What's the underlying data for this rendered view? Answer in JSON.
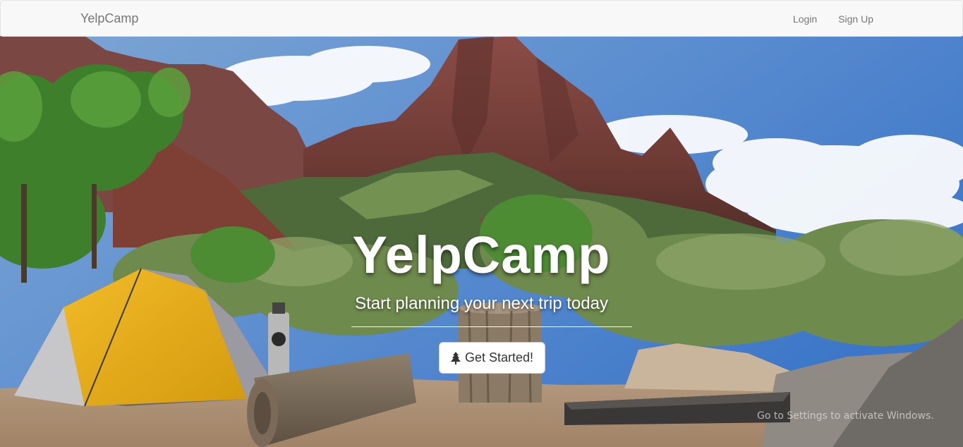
{
  "navbar": {
    "brand": "YelpCamp",
    "links": [
      {
        "label": "Login"
      },
      {
        "label": "Sign Up"
      }
    ]
  },
  "landing": {
    "title": "YelpCamp",
    "subtitle": "Start planning your next trip today",
    "cta_label": "Get Started!",
    "cta_icon": "tree-icon"
  },
  "watermark": {
    "text": "Go to Settings to activate Windows."
  },
  "colors": {
    "navbar_bg": "#f8f8f8",
    "nav_text": "#777777",
    "title_text": "#ffffff",
    "button_bg": "#ffffff",
    "button_text": "#333333"
  }
}
